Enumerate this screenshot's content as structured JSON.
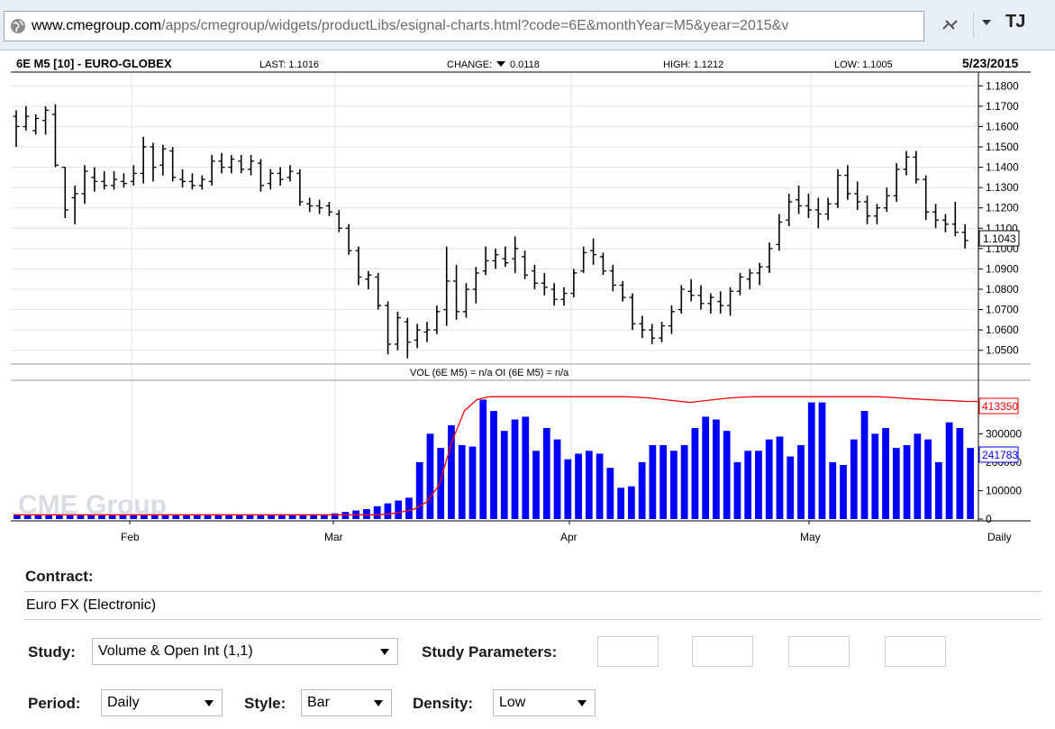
{
  "browser": {
    "url_domain": "www.cmegroup.com",
    "url_path": "/apps/cmegroup/widgets/productLibs/esignal-charts.html?code=6E&monthYear=M5&year=2015&v",
    "profile_initials": "TJ"
  },
  "chart_header": {
    "symbol": "6E M5 [10] - EURO-GLOBEX",
    "last": "LAST: 1.1016",
    "change_label": "CHANGE:",
    "change_value": "0.0118",
    "high": "HIGH: 1.1212",
    "low": "LOW: 1.1005",
    "date": "5/23/2015"
  },
  "volume_header": "VOL (6E M5) = n/a OI (6E M5) = n/a",
  "watermark": "CME Group",
  "colors": {
    "volume": "#0000ff",
    "open_interest": "#ff0000",
    "price": "#000000"
  },
  "chart_data": [
    {
      "type": "ohlc",
      "ylim": [
        1.045,
        1.185
      ],
      "y_ticks": [
        "1.1800",
        "1.1700",
        "1.1600",
        "1.1500",
        "1.1400",
        "1.1300",
        "1.1200",
        "1.1100",
        "1.1000",
        "1.0900",
        "1.0800",
        "1.0700",
        "1.0600",
        "1.0500"
      ],
      "last_price_label": "1.1043",
      "x_labels": [
        "Feb",
        "Mar",
        "Apr",
        "May",
        "Daily"
      ],
      "bars": [
        {
          "o": 1.165,
          "h": 1.168,
          "l": 1.15,
          "c": 1.16
        },
        {
          "o": 1.16,
          "h": 1.17,
          "l": 1.158,
          "c": 1.165
        },
        {
          "o": 1.158,
          "h": 1.166,
          "l": 1.156,
          "c": 1.164
        },
        {
          "o": 1.163,
          "h": 1.17,
          "l": 1.156,
          "c": 1.168
        },
        {
          "o": 1.166,
          "h": 1.171,
          "l": 1.14,
          "c": 1.141
        },
        {
          "o": 1.14,
          "h": 1.14,
          "l": 1.115,
          "c": 1.119
        },
        {
          "o": 1.125,
          "h": 1.131,
          "l": 1.112,
          "c": 1.127
        },
        {
          "o": 1.127,
          "h": 1.141,
          "l": 1.122,
          "c": 1.138
        },
        {
          "o": 1.135,
          "h": 1.14,
          "l": 1.128,
          "c": 1.133
        },
        {
          "o": 1.133,
          "h": 1.138,
          "l": 1.129,
          "c": 1.131
        },
        {
          "o": 1.131,
          "h": 1.138,
          "l": 1.129,
          "c": 1.134
        },
        {
          "o": 1.133,
          "h": 1.137,
          "l": 1.13,
          "c": 1.132
        },
        {
          "o": 1.133,
          "h": 1.141,
          "l": 1.131,
          "c": 1.137
        },
        {
          "o": 1.137,
          "h": 1.155,
          "l": 1.132,
          "c": 1.15
        },
        {
          "o": 1.15,
          "h": 1.152,
          "l": 1.133,
          "c": 1.14
        },
        {
          "o": 1.141,
          "h": 1.151,
          "l": 1.136,
          "c": 1.149
        },
        {
          "o": 1.148,
          "h": 1.15,
          "l": 1.133,
          "c": 1.135
        },
        {
          "o": 1.134,
          "h": 1.139,
          "l": 1.13,
          "c": 1.133
        },
        {
          "o": 1.133,
          "h": 1.137,
          "l": 1.129,
          "c": 1.131
        },
        {
          "o": 1.131,
          "h": 1.136,
          "l": 1.129,
          "c": 1.134
        },
        {
          "o": 1.133,
          "h": 1.146,
          "l": 1.131,
          "c": 1.143
        },
        {
          "o": 1.143,
          "h": 1.147,
          "l": 1.137,
          "c": 1.14
        },
        {
          "o": 1.14,
          "h": 1.146,
          "l": 1.137,
          "c": 1.144
        },
        {
          "o": 1.143,
          "h": 1.146,
          "l": 1.137,
          "c": 1.139
        },
        {
          "o": 1.139,
          "h": 1.146,
          "l": 1.136,
          "c": 1.143
        },
        {
          "o": 1.142,
          "h": 1.144,
          "l": 1.128,
          "c": 1.131
        },
        {
          "o": 1.132,
          "h": 1.139,
          "l": 1.129,
          "c": 1.137
        },
        {
          "o": 1.137,
          "h": 1.14,
          "l": 1.131,
          "c": 1.134
        },
        {
          "o": 1.135,
          "h": 1.141,
          "l": 1.133,
          "c": 1.138
        },
        {
          "o": 1.137,
          "h": 1.139,
          "l": 1.121,
          "c": 1.123
        },
        {
          "o": 1.122,
          "h": 1.125,
          "l": 1.118,
          "c": 1.121
        },
        {
          "o": 1.121,
          "h": 1.124,
          "l": 1.117,
          "c": 1.12
        },
        {
          "o": 1.121,
          "h": 1.123,
          "l": 1.116,
          "c": 1.118
        },
        {
          "o": 1.117,
          "h": 1.119,
          "l": 1.108,
          "c": 1.11
        },
        {
          "o": 1.11,
          "h": 1.112,
          "l": 1.097,
          "c": 1.099
        },
        {
          "o": 1.099,
          "h": 1.101,
          "l": 1.082,
          "c": 1.086
        },
        {
          "o": 1.085,
          "h": 1.089,
          "l": 1.08,
          "c": 1.087
        },
        {
          "o": 1.086,
          "h": 1.088,
          "l": 1.07,
          "c": 1.072
        },
        {
          "o": 1.072,
          "h": 1.074,
          "l": 1.048,
          "c": 1.053
        },
        {
          "o": 1.053,
          "h": 1.069,
          "l": 1.05,
          "c": 1.066
        },
        {
          "o": 1.064,
          "h": 1.066,
          "l": 1.046,
          "c": 1.054
        },
        {
          "o": 1.055,
          "h": 1.063,
          "l": 1.051,
          "c": 1.06
        },
        {
          "o": 1.059,
          "h": 1.064,
          "l": 1.054,
          "c": 1.06
        },
        {
          "o": 1.06,
          "h": 1.072,
          "l": 1.058,
          "c": 1.069
        },
        {
          "o": 1.07,
          "h": 1.101,
          "l": 1.062,
          "c": 1.084
        },
        {
          "o": 1.084,
          "h": 1.092,
          "l": 1.065,
          "c": 1.069
        },
        {
          "o": 1.069,
          "h": 1.083,
          "l": 1.066,
          "c": 1.08
        },
        {
          "o": 1.08,
          "h": 1.091,
          "l": 1.073,
          "c": 1.088
        },
        {
          "o": 1.089,
          "h": 1.101,
          "l": 1.087,
          "c": 1.094
        },
        {
          "o": 1.094,
          "h": 1.1,
          "l": 1.09,
          "c": 1.097
        },
        {
          "o": 1.095,
          "h": 1.101,
          "l": 1.091,
          "c": 1.093
        },
        {
          "o": 1.095,
          "h": 1.106,
          "l": 1.088,
          "c": 1.1
        },
        {
          "o": 1.096,
          "h": 1.099,
          "l": 1.085,
          "c": 1.087
        },
        {
          "o": 1.089,
          "h": 1.092,
          "l": 1.08,
          "c": 1.083
        },
        {
          "o": 1.083,
          "h": 1.088,
          "l": 1.077,
          "c": 1.081
        },
        {
          "o": 1.08,
          "h": 1.083,
          "l": 1.072,
          "c": 1.075
        },
        {
          "o": 1.075,
          "h": 1.081,
          "l": 1.072,
          "c": 1.078
        },
        {
          "o": 1.078,
          "h": 1.09,
          "l": 1.076,
          "c": 1.088
        },
        {
          "o": 1.089,
          "h": 1.101,
          "l": 1.088,
          "c": 1.098
        },
        {
          "o": 1.099,
          "h": 1.105,
          "l": 1.092,
          "c": 1.097
        },
        {
          "o": 1.096,
          "h": 1.098,
          "l": 1.087,
          "c": 1.089
        },
        {
          "o": 1.089,
          "h": 1.092,
          "l": 1.079,
          "c": 1.082
        },
        {
          "o": 1.082,
          "h": 1.084,
          "l": 1.074,
          "c": 1.076
        },
        {
          "o": 1.076,
          "h": 1.078,
          "l": 1.06,
          "c": 1.063
        },
        {
          "o": 1.063,
          "h": 1.067,
          "l": 1.056,
          "c": 1.06
        },
        {
          "o": 1.06,
          "h": 1.063,
          "l": 1.053,
          "c": 1.056
        },
        {
          "o": 1.056,
          "h": 1.064,
          "l": 1.054,
          "c": 1.062
        },
        {
          "o": 1.062,
          "h": 1.072,
          "l": 1.058,
          "c": 1.069
        },
        {
          "o": 1.07,
          "h": 1.082,
          "l": 1.068,
          "c": 1.08
        },
        {
          "o": 1.079,
          "h": 1.085,
          "l": 1.074,
          "c": 1.077
        },
        {
          "o": 1.077,
          "h": 1.082,
          "l": 1.07,
          "c": 1.073
        },
        {
          "o": 1.073,
          "h": 1.078,
          "l": 1.068,
          "c": 1.076
        },
        {
          "o": 1.074,
          "h": 1.079,
          "l": 1.068,
          "c": 1.072
        },
        {
          "o": 1.072,
          "h": 1.081,
          "l": 1.067,
          "c": 1.079
        },
        {
          "o": 1.079,
          "h": 1.088,
          "l": 1.077,
          "c": 1.086
        },
        {
          "o": 1.085,
          "h": 1.09,
          "l": 1.08,
          "c": 1.088
        },
        {
          "o": 1.088,
          "h": 1.093,
          "l": 1.082,
          "c": 1.091
        },
        {
          "o": 1.091,
          "h": 1.103,
          "l": 1.088,
          "c": 1.1
        },
        {
          "o": 1.102,
          "h": 1.117,
          "l": 1.099,
          "c": 1.113
        },
        {
          "o": 1.114,
          "h": 1.127,
          "l": 1.111,
          "c": 1.123
        },
        {
          "o": 1.124,
          "h": 1.131,
          "l": 1.117,
          "c": 1.121
        },
        {
          "o": 1.121,
          "h": 1.127,
          "l": 1.115,
          "c": 1.119
        },
        {
          "o": 1.119,
          "h": 1.125,
          "l": 1.11,
          "c": 1.117
        },
        {
          "o": 1.117,
          "h": 1.125,
          "l": 1.114,
          "c": 1.122
        },
        {
          "o": 1.122,
          "h": 1.139,
          "l": 1.12,
          "c": 1.136
        },
        {
          "o": 1.136,
          "h": 1.141,
          "l": 1.124,
          "c": 1.127
        },
        {
          "o": 1.127,
          "h": 1.133,
          "l": 1.119,
          "c": 1.123
        },
        {
          "o": 1.123,
          "h": 1.126,
          "l": 1.112,
          "c": 1.116
        },
        {
          "o": 1.116,
          "h": 1.122,
          "l": 1.112,
          "c": 1.12
        },
        {
          "o": 1.12,
          "h": 1.13,
          "l": 1.118,
          "c": 1.126
        },
        {
          "o": 1.126,
          "h": 1.142,
          "l": 1.123,
          "c": 1.139
        },
        {
          "o": 1.139,
          "h": 1.148,
          "l": 1.136,
          "c": 1.145
        },
        {
          "o": 1.145,
          "h": 1.148,
          "l": 1.132,
          "c": 1.134
        },
        {
          "o": 1.134,
          "h": 1.136,
          "l": 1.114,
          "c": 1.118
        },
        {
          "o": 1.118,
          "h": 1.122,
          "l": 1.11,
          "c": 1.114
        },
        {
          "o": 1.114,
          "h": 1.117,
          "l": 1.108,
          "c": 1.112
        },
        {
          "o": 1.112,
          "h": 1.123,
          "l": 1.106,
          "c": 1.108
        },
        {
          "o": 1.108,
          "h": 1.112,
          "l": 1.1,
          "c": 1.104
        }
      ]
    },
    {
      "type": "bar+line",
      "ylim": [
        0,
        450000
      ],
      "y_ticks": [
        "300000",
        "200000",
        "100000",
        "0"
      ],
      "series": [
        {
          "name": "VOL (6E M5)",
          "values": [
            15000,
            15000,
            15000,
            15000,
            15000,
            15000,
            15000,
            15000,
            15000,
            15000,
            15000,
            15000,
            15000,
            15000,
            15000,
            15000,
            15000,
            15000,
            15000,
            15000,
            15000,
            15000,
            15000,
            15000,
            15000,
            15000,
            15000,
            15000,
            15000,
            15000,
            20000,
            25000,
            30000,
            35000,
            45000,
            55000,
            65000,
            75000,
            200000,
            300000,
            250000,
            330000,
            260000,
            255000,
            420000,
            380000,
            310000,
            350000,
            360000,
            240000,
            320000,
            280000,
            210000,
            230000,
            240000,
            230000,
            180000,
            110000,
            115000,
            200000,
            260000,
            260000,
            240000,
            260000,
            320000,
            360000,
            350000,
            310000,
            200000,
            240000,
            240000,
            280000,
            290000,
            220000,
            260000,
            410000,
            410000,
            200000,
            190000,
            280000,
            380000,
            300000,
            320000,
            250000,
            260000,
            300000,
            280000,
            200000,
            340000,
            320000,
            250000
          ]
        },
        {
          "name": "OI (6E M5)",
          "values": [
            15000,
            15000,
            15000,
            15000,
            15000,
            15000,
            15000,
            15000,
            15000,
            15000,
            15000,
            15000,
            15000,
            15000,
            15000,
            15000,
            15000,
            15000,
            15000,
            15000,
            15000,
            15000,
            15000,
            15000,
            15000,
            15000,
            15000,
            15000,
            15000,
            15000,
            18000,
            25000,
            35000,
            60000,
            120000,
            270000,
            380000,
            420000,
            430000,
            430000,
            430000,
            430000,
            430000,
            430000,
            430000,
            430000,
            430000,
            430000,
            430000,
            430000,
            428000,
            425000,
            420000,
            415000,
            410000,
            415000,
            420000,
            425000,
            428000,
            430000,
            430000,
            430000,
            430000,
            430000,
            430000,
            430000,
            430000,
            430000,
            430000,
            430000,
            428000,
            425000,
            422000,
            420000,
            418000,
            416000,
            414000,
            413350
          ]
        }
      ],
      "oi_label": "413350",
      "vol_label": "241783"
    }
  ],
  "form": {
    "contract_label": "Contract:",
    "contract_value": "Euro FX (Electronic)",
    "study_label": "Study:",
    "study_value": "Volume & Open Int (1,1)",
    "study_params_label": "Study Parameters:",
    "period_label": "Period:",
    "period_value": "Daily",
    "style_label": "Style:",
    "style_value": "Bar",
    "density_label": "Density:",
    "density_value": "Low"
  }
}
